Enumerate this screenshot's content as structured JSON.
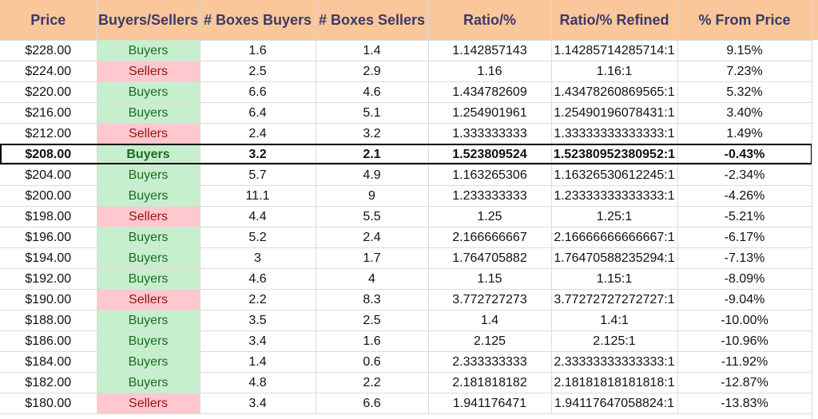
{
  "headers": [
    "Price",
    "Buyers/Sellers",
    "# Boxes Buyers",
    "# Boxes Sellers",
    "Ratio/%",
    "Ratio/% Refined",
    "% From Price"
  ],
  "highlight_row_index": 5,
  "colors": {
    "header_bg": "#f9c79a",
    "buyers_bg": "#c6efce",
    "buyers_text": "#1e6b22",
    "sellers_bg": "#ffc7ce",
    "sellers_text": "#9c1010"
  },
  "rows": [
    {
      "price": "$228.00",
      "side": "Buyers",
      "boxes_buyers": "1.6",
      "boxes_sellers": "1.4",
      "ratio": "1.142857143",
      "ratio_refined": "1.14285714285714:1",
      "from_price": "9.15%"
    },
    {
      "price": "$224.00",
      "side": "Sellers",
      "boxes_buyers": "2.5",
      "boxes_sellers": "2.9",
      "ratio": "1.16",
      "ratio_refined": "1.16:1",
      "from_price": "7.23%"
    },
    {
      "price": "$220.00",
      "side": "Buyers",
      "boxes_buyers": "6.6",
      "boxes_sellers": "4.6",
      "ratio": "1.434782609",
      "ratio_refined": "1.43478260869565:1",
      "from_price": "5.32%"
    },
    {
      "price": "$216.00",
      "side": "Buyers",
      "boxes_buyers": "6.4",
      "boxes_sellers": "5.1",
      "ratio": "1.254901961",
      "ratio_refined": "1.25490196078431:1",
      "from_price": "3.40%"
    },
    {
      "price": "$212.00",
      "side": "Sellers",
      "boxes_buyers": "2.4",
      "boxes_sellers": "3.2",
      "ratio": "1.333333333",
      "ratio_refined": "1.33333333333333:1",
      "from_price": "1.49%"
    },
    {
      "price": "$208.00",
      "side": "Buyers",
      "boxes_buyers": "3.2",
      "boxes_sellers": "2.1",
      "ratio": "1.523809524",
      "ratio_refined": "1.52380952380952:1",
      "from_price": "-0.43%"
    },
    {
      "price": "$204.00",
      "side": "Buyers",
      "boxes_buyers": "5.7",
      "boxes_sellers": "4.9",
      "ratio": "1.163265306",
      "ratio_refined": "1.16326530612245:1",
      "from_price": "-2.34%"
    },
    {
      "price": "$200.00",
      "side": "Buyers",
      "boxes_buyers": "11.1",
      "boxes_sellers": "9",
      "ratio": "1.233333333",
      "ratio_refined": "1.23333333333333:1",
      "from_price": "-4.26%"
    },
    {
      "price": "$198.00",
      "side": "Sellers",
      "boxes_buyers": "4.4",
      "boxes_sellers": "5.5",
      "ratio": "1.25",
      "ratio_refined": "1.25:1",
      "from_price": "-5.21%"
    },
    {
      "price": "$196.00",
      "side": "Buyers",
      "boxes_buyers": "5.2",
      "boxes_sellers": "2.4",
      "ratio": "2.166666667",
      "ratio_refined": "2.16666666666667:1",
      "from_price": "-6.17%"
    },
    {
      "price": "$194.00",
      "side": "Buyers",
      "boxes_buyers": "3",
      "boxes_sellers": "1.7",
      "ratio": "1.764705882",
      "ratio_refined": "1.76470588235294:1",
      "from_price": "-7.13%"
    },
    {
      "price": "$192.00",
      "side": "Buyers",
      "boxes_buyers": "4.6",
      "boxes_sellers": "4",
      "ratio": "1.15",
      "ratio_refined": "1.15:1",
      "from_price": "-8.09%"
    },
    {
      "price": "$190.00",
      "side": "Sellers",
      "boxes_buyers": "2.2",
      "boxes_sellers": "8.3",
      "ratio": "3.772727273",
      "ratio_refined": "3.77272727272727:1",
      "from_price": "-9.04%"
    },
    {
      "price": "$188.00",
      "side": "Buyers",
      "boxes_buyers": "3.5",
      "boxes_sellers": "2.5",
      "ratio": "1.4",
      "ratio_refined": "1.4:1",
      "from_price": "-10.00%"
    },
    {
      "price": "$186.00",
      "side": "Buyers",
      "boxes_buyers": "3.4",
      "boxes_sellers": "1.6",
      "ratio": "2.125",
      "ratio_refined": "2.125:1",
      "from_price": "-10.96%"
    },
    {
      "price": "$184.00",
      "side": "Buyers",
      "boxes_buyers": "1.4",
      "boxes_sellers": "0.6",
      "ratio": "2.333333333",
      "ratio_refined": "2.33333333333333:1",
      "from_price": "-11.92%"
    },
    {
      "price": "$182.00",
      "side": "Buyers",
      "boxes_buyers": "4.8",
      "boxes_sellers": "2.2",
      "ratio": "2.181818182",
      "ratio_refined": "2.18181818181818:1",
      "from_price": "-12.87%"
    },
    {
      "price": "$180.00",
      "side": "Sellers",
      "boxes_buyers": "3.4",
      "boxes_sellers": "6.6",
      "ratio": "1.941176471",
      "ratio_refined": "1.94117647058824:1",
      "from_price": "-13.83%"
    }
  ]
}
